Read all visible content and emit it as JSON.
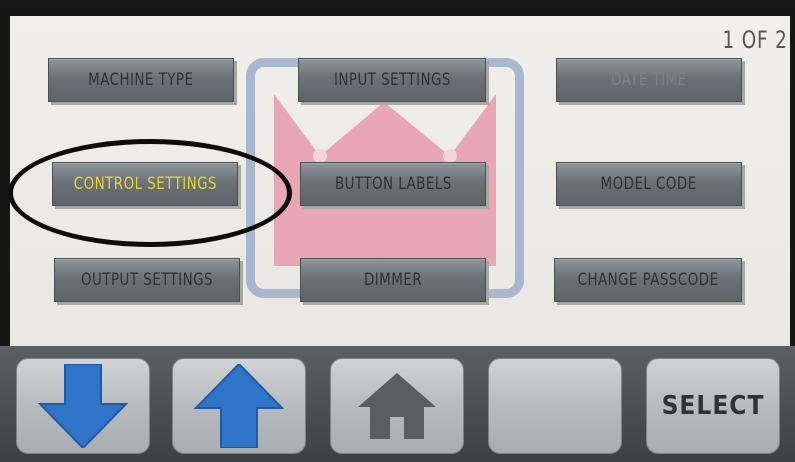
{
  "page_indicator": "1 OF 2",
  "menu": {
    "machine_type": "MACHINE TYPE",
    "input_settings": "INPUT SETTINGS",
    "date_time": "DATE TIME",
    "control_settings": "CONTROL SETTINGS",
    "button_labels": "BUTTON LABELS",
    "model_code": "MODEL CODE",
    "output_settings": "OUTPUT SETTINGS",
    "dimmer": "DIMMER",
    "change_passcode": "CHANGE PASSCODE"
  },
  "toolbar": {
    "down_icon": "arrow-down-icon",
    "up_icon": "arrow-up-icon",
    "home_icon": "home-icon",
    "select_label": "SELECT"
  },
  "colors": {
    "selected_text": "#e8d23a",
    "arrow_blue": "#2f74c9",
    "logo_pink": "#e9a6b4",
    "logo_frame": "#a9b7cf",
    "annotation_circle": "#0d0d0d"
  }
}
